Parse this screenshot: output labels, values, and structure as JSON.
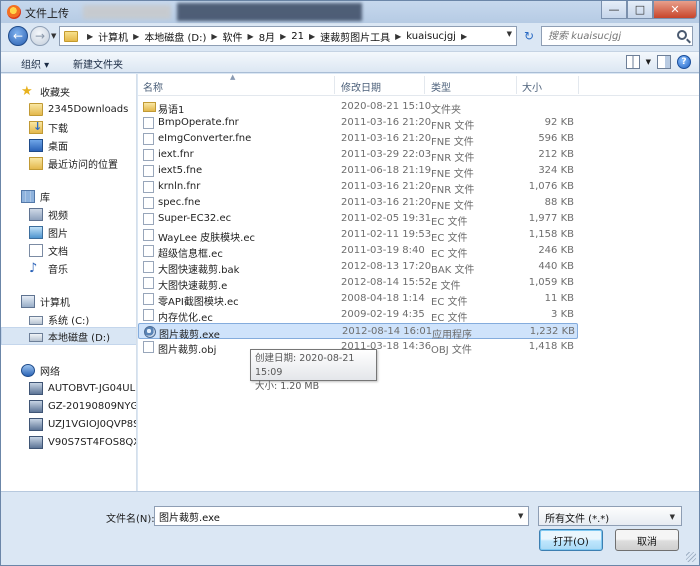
{
  "window": {
    "title": "文件上传",
    "buttons": {
      "minimize": "—",
      "maximize": "□",
      "close": "✕"
    }
  },
  "address": {
    "crumbs": [
      "计算机",
      "本地磁盘 (D:)",
      "软件",
      "8月",
      "21",
      "速裁剪图片工具",
      "kuaisucjgj"
    ],
    "search_placeholder": "搜索 kuaisucjgj"
  },
  "toolbar": {
    "organize": "组织 ▾",
    "new_folder": "新建文件夹"
  },
  "nav": {
    "favorites": {
      "title": "收藏夹",
      "items": [
        "2345Downloads",
        "下载",
        "桌面",
        "最近访问的位置"
      ]
    },
    "libraries": {
      "title": "库",
      "items": [
        "视频",
        "图片",
        "文档",
        "音乐"
      ]
    },
    "computer": {
      "title": "计算机",
      "items": [
        "系统 (C:)",
        "本地磁盘 (D:)"
      ]
    },
    "network": {
      "title": "网络",
      "items": [
        "AUTOBVT-JG04UL",
        "GZ-20190809NYGZ",
        "UZJ1VGIOJ0QVP8S",
        "V90S7ST4FOS8QX"
      ]
    }
  },
  "columns": {
    "name": "名称",
    "date": "修改日期",
    "type": "类型",
    "size": "大小"
  },
  "files": [
    {
      "name": "易语1",
      "date": "2020-08-21 15:10",
      "type": "文件夹",
      "size": "",
      "icon": "folder-icon"
    },
    {
      "name": "BmpOperate.fnr",
      "date": "2011-03-16 21:20",
      "type": "FNR 文件",
      "size": "92 KB",
      "icon": "file-icon"
    },
    {
      "name": "eImgConverter.fne",
      "date": "2011-03-16 21:20",
      "type": "FNE 文件",
      "size": "596 KB",
      "icon": "file-icon"
    },
    {
      "name": "iext.fnr",
      "date": "2011-03-29 22:03",
      "type": "FNR 文件",
      "size": "212 KB",
      "icon": "file-icon"
    },
    {
      "name": "iext5.fne",
      "date": "2011-06-18 21:19",
      "type": "FNE 文件",
      "size": "324 KB",
      "icon": "file-icon"
    },
    {
      "name": "krnln.fnr",
      "date": "2011-03-16 21:20",
      "type": "FNR 文件",
      "size": "1,076 KB",
      "icon": "file-icon"
    },
    {
      "name": "spec.fne",
      "date": "2011-03-16 21:20",
      "type": "FNE 文件",
      "size": "88 KB",
      "icon": "file-icon"
    },
    {
      "name": "Super-EC32.ec",
      "date": "2011-02-05 19:31",
      "type": "EC 文件",
      "size": "1,977 KB",
      "icon": "file-icon"
    },
    {
      "name": "WayLee 皮肤模块.ec",
      "date": "2011-02-11 19:53",
      "type": "EC 文件",
      "size": "1,158 KB",
      "icon": "file-icon"
    },
    {
      "name": "超级信息框.ec",
      "date": "2011-03-19 8:40",
      "type": "EC 文件",
      "size": "246 KB",
      "icon": "file-icon"
    },
    {
      "name": "大图快速裁剪.bak",
      "date": "2012-08-13 17:20",
      "type": "BAK 文件",
      "size": "440 KB",
      "icon": "file-icon"
    },
    {
      "name": "大图快速裁剪.e",
      "date": "2012-08-14 15:52",
      "type": "E 文件",
      "size": "1,059 KB",
      "icon": "file-icon"
    },
    {
      "name": "零API截图模块.ec",
      "date": "2008-04-18 1:14",
      "type": "EC 文件",
      "size": "11 KB",
      "icon": "file-icon"
    },
    {
      "name": "内存优化.ec",
      "date": "2009-02-19 4:35",
      "type": "EC 文件",
      "size": "3 KB",
      "icon": "file-icon"
    },
    {
      "name": "图片裁剪.exe",
      "date": "2012-08-14 16:01",
      "type": "应用程序",
      "size": "1,232 KB",
      "icon": "app-icon",
      "selected": true
    },
    {
      "name": "图片裁剪.obj",
      "date": "2011-03-18 14:36",
      "type": "OBJ 文件",
      "size": "1,418 KB",
      "icon": "file-icon"
    }
  ],
  "tooltip": {
    "created": "创建日期: 2020-08-21 15:09",
    "size": "大小: 1.20 MB"
  },
  "bottom": {
    "filename_label": "文件名(N):",
    "filename_value": "图片裁剪.exe",
    "filetype_value": "所有文件 (*.*)",
    "open_label": "打开(O)",
    "cancel_label": "取消"
  }
}
